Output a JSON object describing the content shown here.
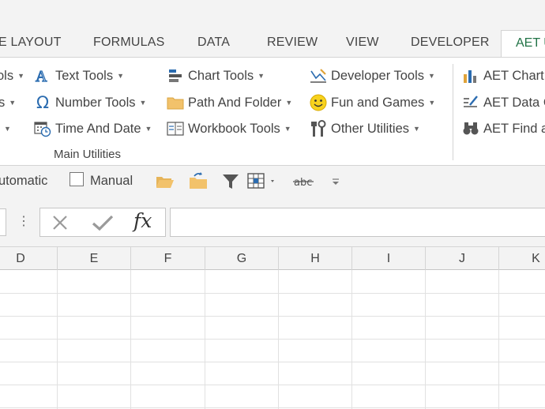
{
  "tabs": [
    "E LAYOUT",
    "FORMULAS",
    "DATA",
    "REVIEW",
    "VIEW",
    "DEVELOPER"
  ],
  "active_tab": "AET U",
  "ribbon": {
    "left_partial": [
      "ols",
      "s",
      ""
    ],
    "col1": [
      "Text Tools",
      "Number Tools",
      "Time And Date"
    ],
    "col2": [
      "Chart Tools",
      "Path And Folder",
      "Workbook Tools"
    ],
    "col3": [
      "Developer Tools",
      "Fun and Games",
      "Other Utilities"
    ],
    "col4": [
      "AET Chart",
      "AET Data C",
      "AET Find a"
    ],
    "group_label": "Main Utilities"
  },
  "quickbar": {
    "automatic_label": "utomatic",
    "manual_label": "Manual"
  },
  "formula": {
    "fx_label": "fx",
    "value": ""
  },
  "columns": [
    "D",
    "E",
    "F",
    "G",
    "H",
    "I",
    "J",
    "K"
  ],
  "colors": {
    "accent": "#217346",
    "ribbon_bg": "#f3f3f3",
    "grid_line": "#e1e1e1"
  }
}
